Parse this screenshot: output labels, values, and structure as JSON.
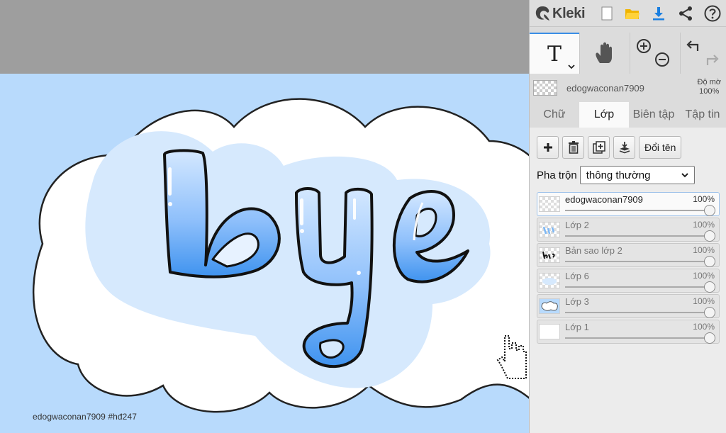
{
  "app": {
    "name": "Kleki"
  },
  "topbar": {
    "buttons": [
      {
        "name": "new-image",
        "icon": "new-file-icon"
      },
      {
        "name": "open",
        "icon": "folder-icon"
      },
      {
        "name": "save",
        "icon": "download-icon"
      },
      {
        "name": "share",
        "icon": "share-icon"
      },
      {
        "name": "help",
        "icon": "help-icon"
      }
    ]
  },
  "tools": {
    "text_tool_icon": "T",
    "items": [
      "text-tool",
      "hand-tool",
      "zoom-in",
      "zoom-out",
      "undo",
      "redo"
    ]
  },
  "layer_info": {
    "name": "edogwaconan7909",
    "opacity_label": "Độ mờ",
    "opacity_value": "100%"
  },
  "tabs": [
    {
      "label": "Chữ",
      "active": false
    },
    {
      "label": "Lớp",
      "active": true
    },
    {
      "label": "Biên tập",
      "active": false
    },
    {
      "label": "Tập tin",
      "active": false
    }
  ],
  "layer_actions": {
    "rename_label": "Đổi tên"
  },
  "blend": {
    "label": "Pha trộn",
    "value": "thông thường"
  },
  "layers": [
    {
      "name": "edogwaconan7909",
      "opacity": "100%",
      "selected": true
    },
    {
      "name": "Lớp 2",
      "opacity": "100%",
      "selected": false
    },
    {
      "name": "Bản sao lớp 2",
      "opacity": "100%",
      "selected": false
    },
    {
      "name": "Lớp 6",
      "opacity": "100%",
      "selected": false
    },
    {
      "name": "Lớp 3",
      "opacity": "100%",
      "selected": false
    },
    {
      "name": "Lớp 1",
      "opacity": "100%",
      "selected": false
    }
  ],
  "canvas": {
    "lettering": "bye",
    "watermark": "edogwaconan7909   #hđ247",
    "colors": {
      "background": "#b8dafc",
      "cloud_inner": "#d6e9fd",
      "letter_top": "#cfe6ff",
      "letter_bottom": "#4a9af0",
      "accent": "#3a8ee6"
    }
  }
}
